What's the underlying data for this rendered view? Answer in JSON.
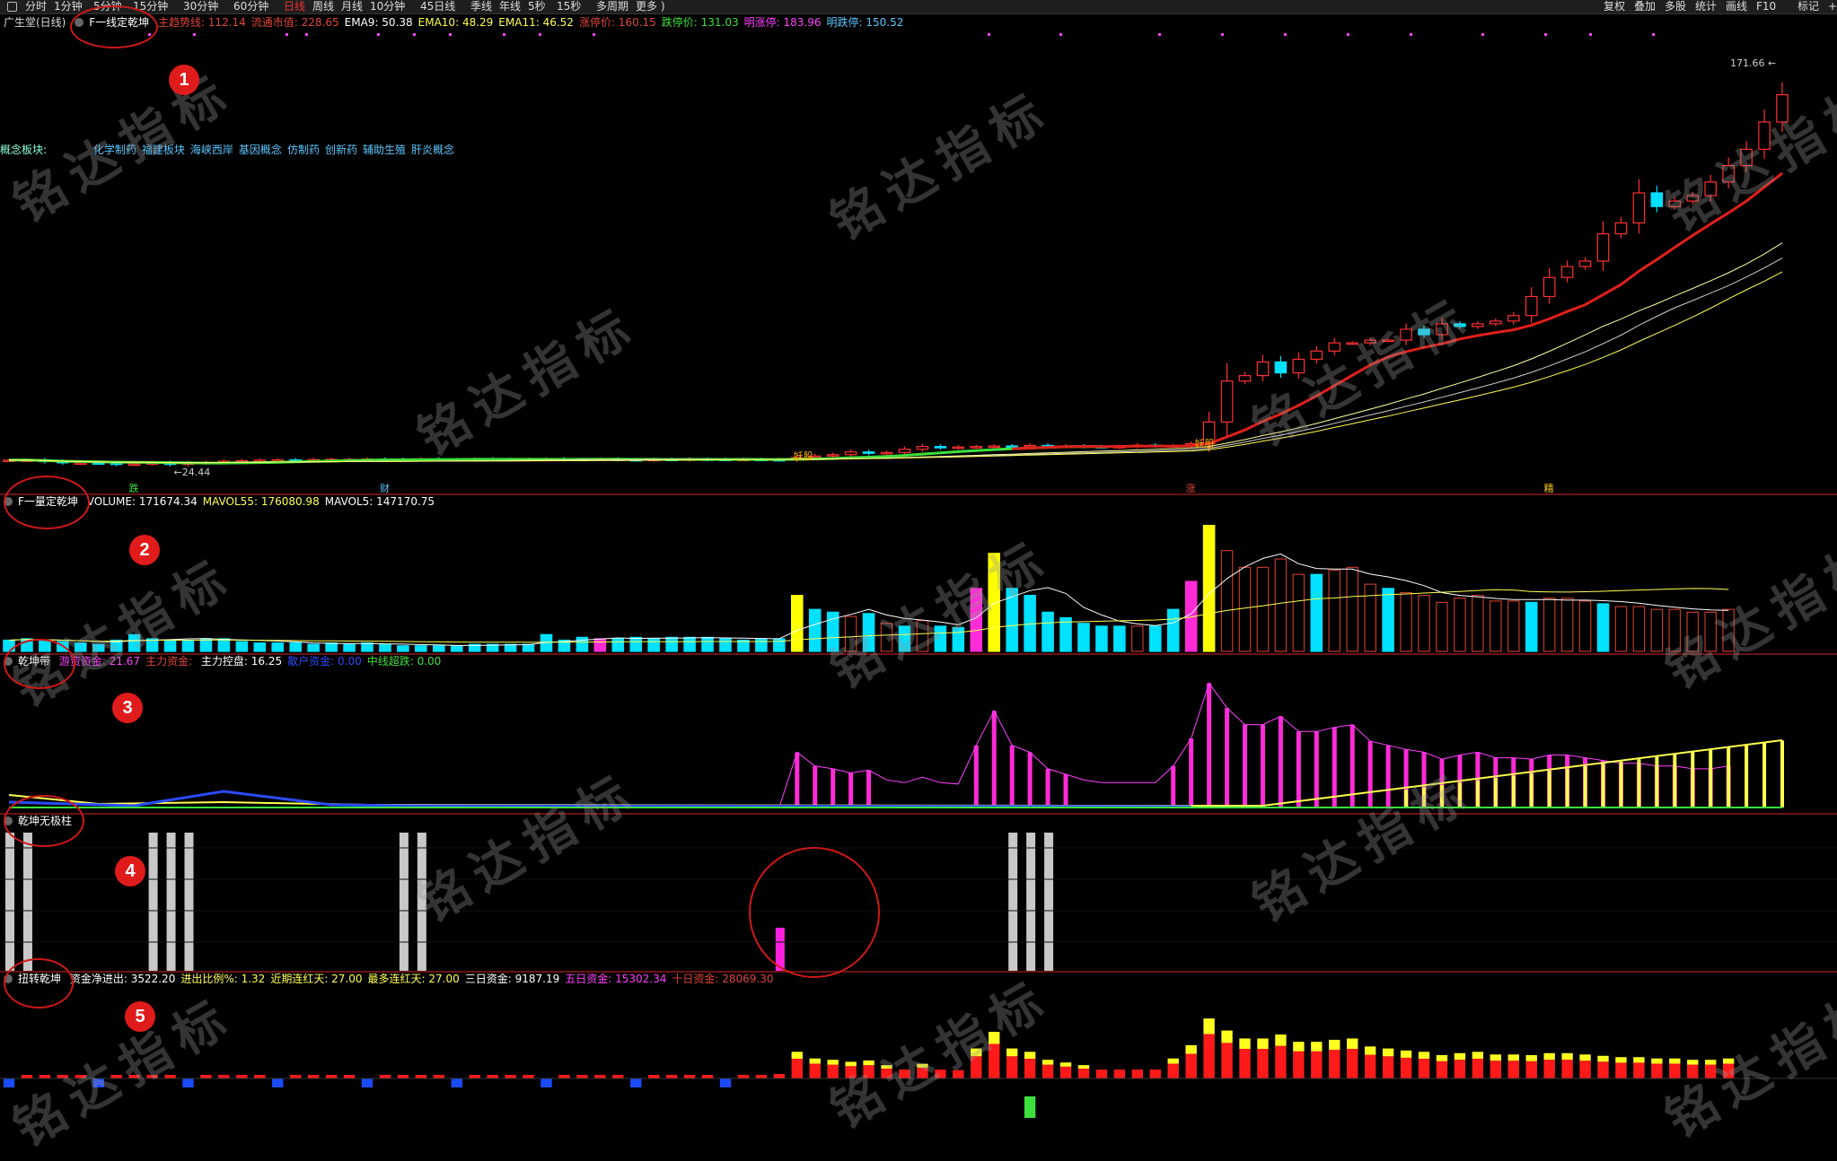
{
  "toolbar": {
    "periods": [
      "分时",
      "1分钟",
      "5分钟",
      "15分钟",
      "30分钟",
      "60分钟",
      "日线",
      "周线",
      "月线",
      "10分钟",
      "45日线",
      "季线",
      "年线",
      "5秒",
      "15秒",
      "多周期",
      "更多 )"
    ],
    "active_period": "日线",
    "right_buttons": [
      "复权",
      "叠加",
      "多股",
      "统计",
      "画线",
      "F10",
      "标记",
      "+自"
    ]
  },
  "main_panel": {
    "stock_name": "广生堂(日线)",
    "indicator": "F一线定乾坤",
    "fields": [
      {
        "label": "主趋势线: ",
        "value": "112.14",
        "color": "#e0463a"
      },
      {
        "label": "流通市值: ",
        "value": "228.65",
        "color": "#e0463a"
      },
      {
        "label": "EMA9: ",
        "value": "50.38",
        "color": "#ffffff"
      },
      {
        "label": "EMA10: ",
        "value": "48.29",
        "color": "#ffff50"
      },
      {
        "label": "EMA11: ",
        "value": "46.52",
        "color": "#ffff50"
      },
      {
        "label": "涨停价: ",
        "value": "160.15",
        "color": "#e0463a"
      },
      {
        "label": "跌停价: ",
        "value": "131.03",
        "color": "#3ce03c"
      },
      {
        "label": "明涨停: ",
        "value": "183.96",
        "color": "#ff40ff"
      },
      {
        "label": "明跌停: ",
        "value": "150.52",
        "color": "#5cc8ff"
      }
    ],
    "concept_label": "概念板块:",
    "concepts": [
      "化学制药",
      "福建板块",
      "海峡西岸",
      "基因概念",
      "仿制药",
      "创新药",
      "辅助生殖",
      "肝炎概念"
    ],
    "high_label": "171.66",
    "low_label": "←24.44",
    "bottom_marks": [
      {
        "text": "跌",
        "color": "#3ce03c"
      },
      {
        "text": "财",
        "color": "#5cc8ff"
      },
      {
        "text": "涨",
        "color": "#e0463a"
      },
      {
        "text": "精",
        "color": "#ffd000"
      }
    ],
    "chart_labels": [
      "妖股",
      "妖股"
    ]
  },
  "volume_panel": {
    "indicator": "F一量定乾坤",
    "fields": [
      {
        "label": "VOLUME: ",
        "value": "171674.34",
        "color": "#ffffff"
      },
      {
        "label": "MAVOL55: ",
        "value": "176080.98",
        "color": "#ffff50"
      },
      {
        "label": "MAVOL5: ",
        "value": "147170.75",
        "color": "#ffffff"
      }
    ]
  },
  "capital_panel": {
    "indicator": "乾坤带",
    "fields": [
      {
        "label": "游资资金: ",
        "value": "21.67",
        "color": "#ff40ff"
      },
      {
        "label": "主力资金: ",
        "value": "",
        "color": "#e0463a"
      },
      {
        "label": "主力控盘: ",
        "value": "16.25",
        "color": "#ffffff"
      },
      {
        "label": "散户资金: ",
        "value": "0.00",
        "color": "#2b4cff"
      },
      {
        "label": "中线超跌: ",
        "value": "0.00",
        "color": "#3ce03c"
      }
    ]
  },
  "pillar_panel": {
    "indicator": "乾坤无极柱"
  },
  "turn_panel": {
    "indicator": "扭转乾坤",
    "fields": [
      {
        "label": "资金净进出: ",
        "value": "3522.20",
        "color": "#ffffff"
      },
      {
        "label": "进出比例%: ",
        "value": "1.32",
        "color": "#ffff50"
      },
      {
        "label": "近期连红天: ",
        "value": "27.00",
        "color": "#ffff50"
      },
      {
        "label": "最多连红天: ",
        "value": "27.00",
        "color": "#ffff50"
      },
      {
        "label": "三日资金: ",
        "value": "9187.19",
        "color": "#ffffff"
      },
      {
        "label": "五日资金: ",
        "value": "15302.34",
        "color": "#ff40ff"
      },
      {
        "label": "十日资金: ",
        "value": "28069.30",
        "color": "#e0463a"
      }
    ]
  },
  "annotations": [
    "1",
    "2",
    "3",
    "4",
    "5"
  ],
  "watermark": "铭达指标",
  "chart_data": [
    {
      "type": "candlestick",
      "title": "广生堂(日线)",
      "note": "Daily K-line, approx. closes read from chart (price units)",
      "closes": [
        26,
        26,
        25.5,
        25,
        25,
        24.9,
        24.5,
        24.6,
        25,
        24.44,
        25,
        25.2,
        25.6,
        25.8,
        26,
        26.1,
        26,
        26.2,
        26.3,
        26.3,
        26.4,
        26.3,
        26.2,
        26.4,
        26.2,
        26.3,
        26.4,
        26.3,
        26.2,
        26.3,
        26.4,
        26.2,
        26.3,
        26.4,
        26.2,
        26.1,
        26.3,
        26.2,
        26.4,
        26.3,
        26.2,
        26.3,
        26.2,
        26.1,
        27,
        27.5,
        28,
        29,
        28.5,
        28.8,
        30,
        31,
        30.5,
        30.8,
        31,
        31.2,
        31,
        31.4,
        31,
        31.2,
        31,
        30.8,
        31,
        31.5,
        31.2,
        31.3,
        32,
        40,
        55,
        57,
        62,
        58,
        63,
        66,
        69,
        69,
        70,
        70,
        74,
        72,
        76,
        75,
        76,
        77,
        79,
        86,
        93,
        97,
        99,
        109,
        113,
        124,
        119,
        121,
        123,
        128,
        134,
        140,
        150,
        160
      ]
    },
    {
      "type": "bar",
      "title": "F一量定乾坤",
      "note": "relative volume heights (0-100 scale)",
      "values": [
        8,
        9,
        8,
        7,
        6,
        5,
        8,
        12,
        9,
        8,
        8,
        9,
        9,
        7,
        6,
        6,
        6,
        5,
        6,
        5,
        6,
        5,
        4,
        4,
        4,
        4,
        5,
        5,
        5,
        5,
        12,
        8,
        10,
        9,
        9,
        10,
        9,
        10,
        10,
        10,
        9,
        8,
        9,
        9,
        40,
        30,
        28,
        25,
        27,
        20,
        18,
        22,
        18,
        17,
        45,
        70,
        45,
        40,
        28,
        24,
        20,
        18,
        18,
        18,
        18,
        30,
        50,
        90,
        72,
        60,
        60,
        66,
        55,
        55,
        58,
        60,
        48,
        45,
        42,
        40,
        35,
        38,
        40,
        36,
        36,
        35,
        38,
        38,
        36,
        34,
        32,
        32,
        30,
        30,
        28,
        28,
        30
      ],
      "series": [
        {
          "name": "MAVOL5",
          "value": 147170.75
        },
        {
          "name": "MAVOL55",
          "value": 176080.98
        }
      ]
    },
    {
      "type": "bar",
      "title": "乾坤带",
      "series": [
        {
          "name": "游资资金",
          "value": 21.67
        },
        {
          "name": "主力控盘",
          "value": 16.25
        },
        {
          "name": "散户资金",
          "value": 0
        },
        {
          "name": "中线超跌",
          "value": 0
        }
      ]
    },
    {
      "type": "bar",
      "title": "乾坤无极柱",
      "note": "grey pillar groups and one magenta pillar"
    },
    {
      "type": "bar",
      "title": "扭转乾坤",
      "series": [
        {
          "name": "资金净进出",
          "value": 3522.2
        },
        {
          "name": "三日资金",
          "value": 9187.19
        },
        {
          "name": "五日资金",
          "value": 15302.34
        },
        {
          "name": "十日资金",
          "value": 28069.3
        }
      ]
    }
  ]
}
